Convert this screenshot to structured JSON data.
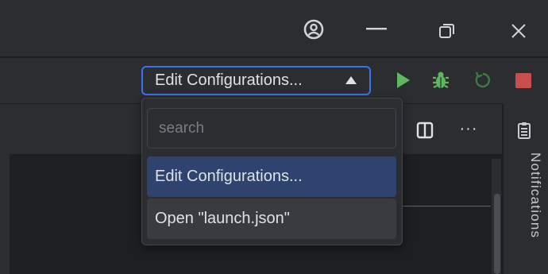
{
  "window_controls": {
    "account_icon": "account-circle-icon",
    "minimize_icon": "minimize-icon",
    "restore_icon": "restore-icon",
    "close_icon": "close-icon"
  },
  "toolbar": {
    "config_button_label": "Edit Configurations...",
    "run_icon": "play-icon",
    "debug_icon": "bug-icon",
    "rerun_icon": "rerun-icon",
    "stop_icon": "stop-icon",
    "accent_color": "#3574f0",
    "run_color": "#5fb85f",
    "stop_color": "#c94f4f"
  },
  "dropdown": {
    "search_placeholder": "search",
    "items": [
      {
        "label": "Edit Configurations..."
      },
      {
        "label": "Open \"launch.json\""
      }
    ]
  },
  "editor_tabs": {
    "split_icon": "split-vertical-icon",
    "more_label": "···"
  },
  "side_panel": {
    "notifications_label": "Notifications",
    "notifications_icon": "notifications-icon"
  }
}
